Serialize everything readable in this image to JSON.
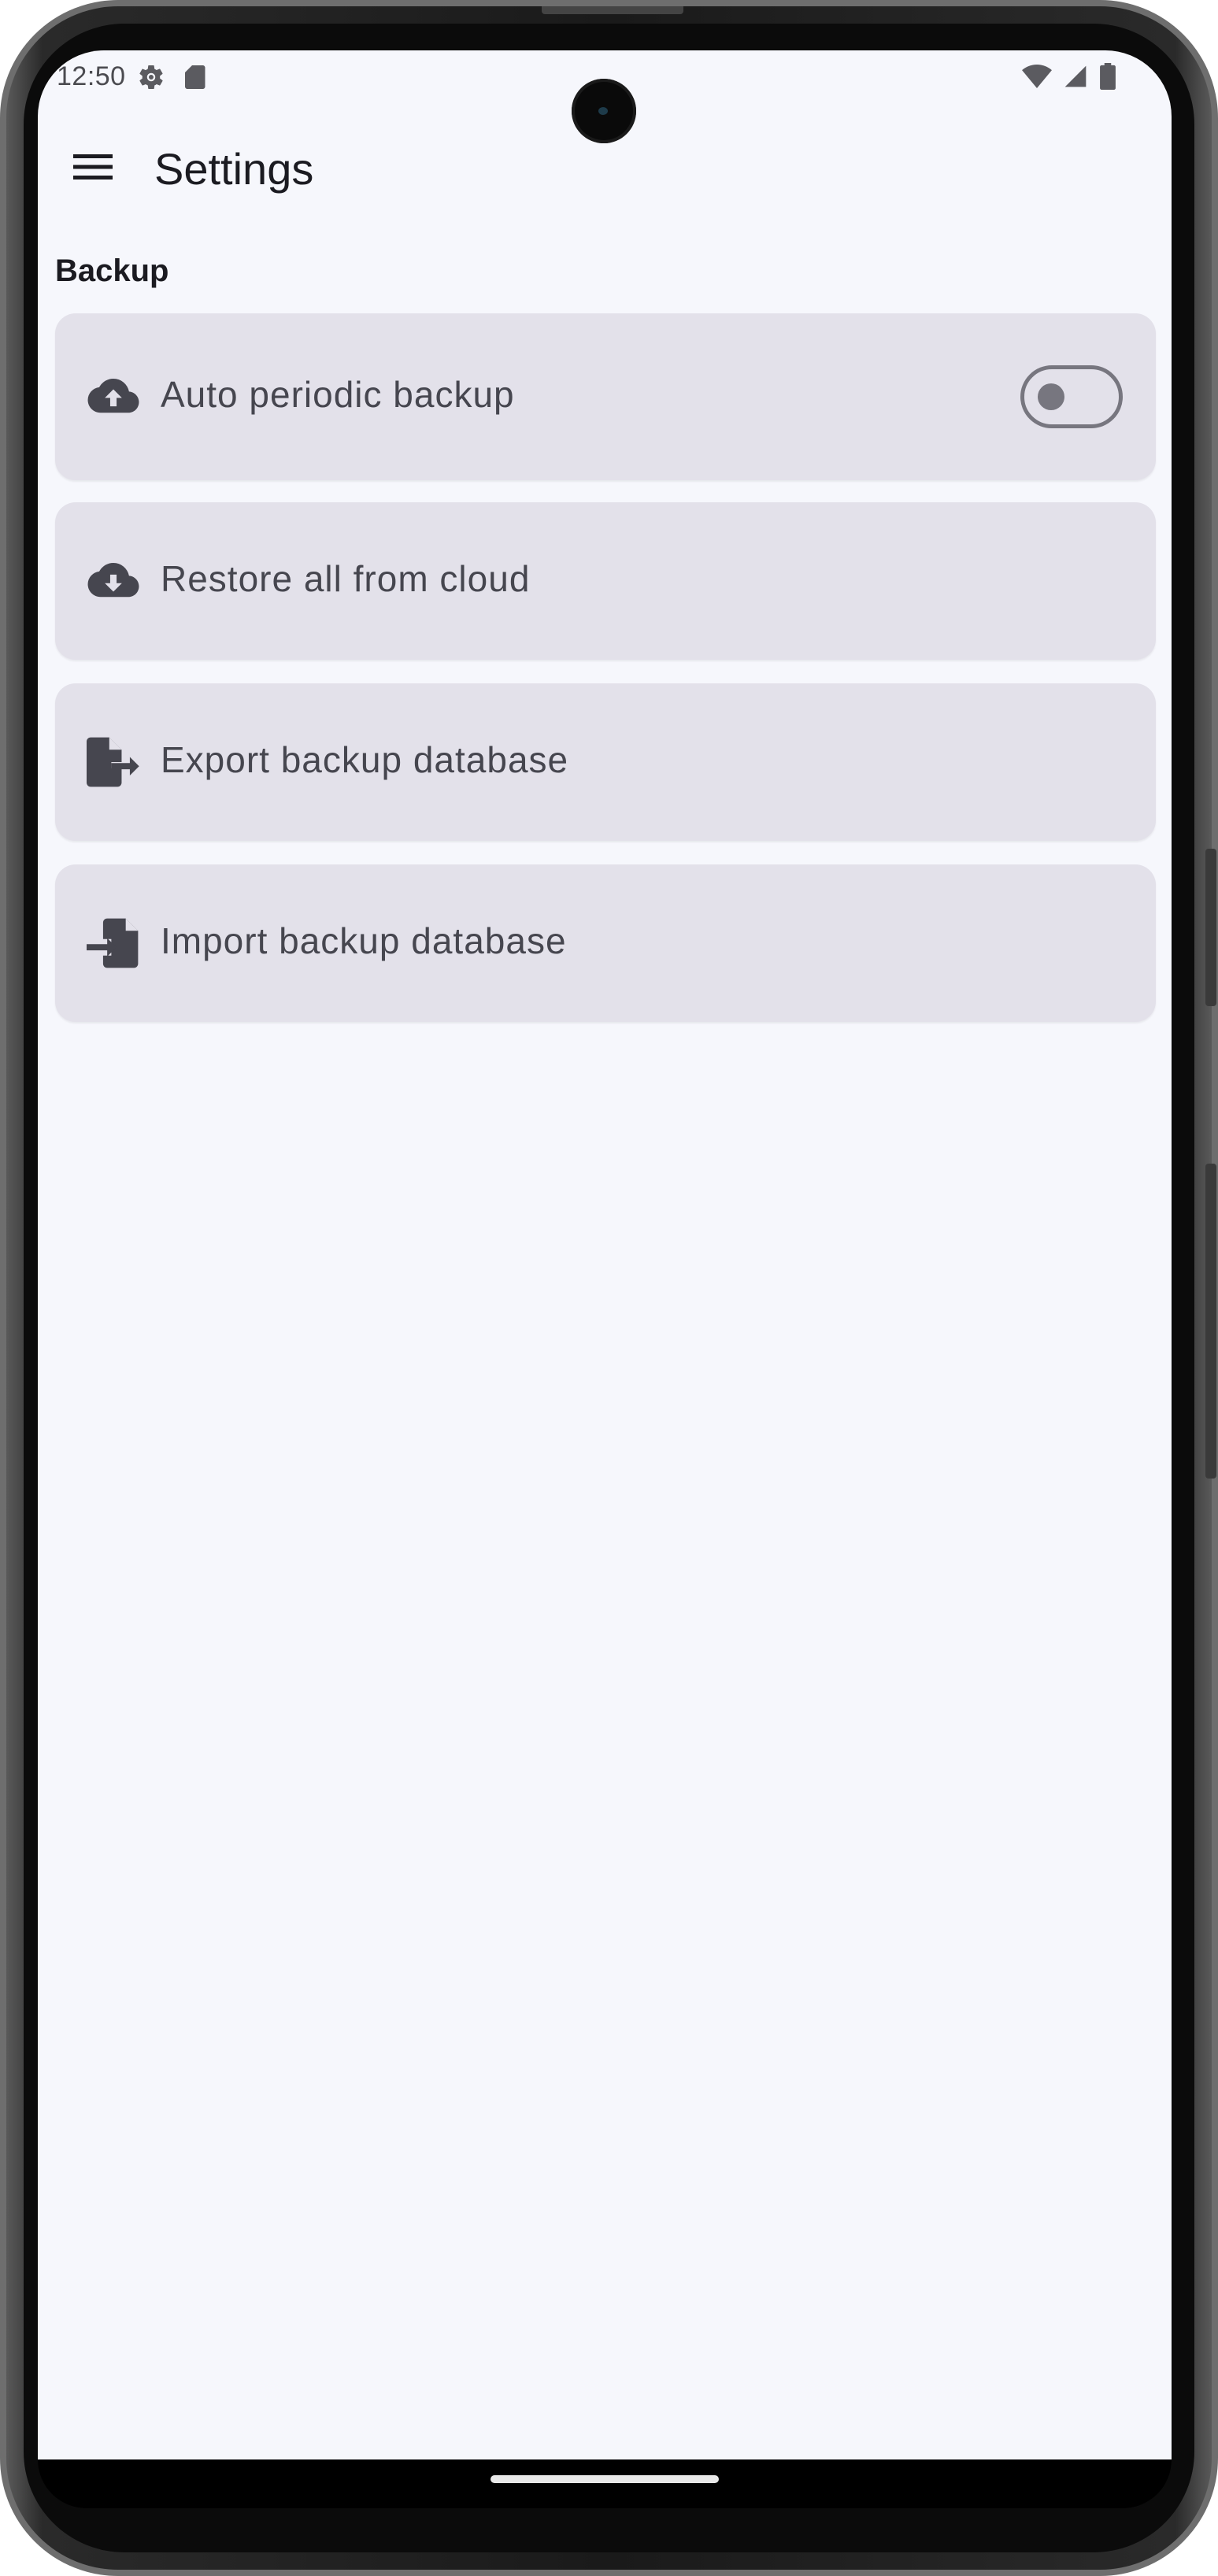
{
  "status_bar": {
    "time": "12:50",
    "left_icons": [
      "settings-gear-icon",
      "sd-card-icon"
    ],
    "right_icons": [
      "wifi-icon",
      "cell-signal-icon",
      "battery-icon"
    ]
  },
  "app_bar": {
    "menu_icon": "hamburger-menu-icon",
    "title": "Settings"
  },
  "sections": [
    {
      "header": "Backup",
      "items": [
        {
          "label": "Auto periodic backup",
          "icon": "cloud-upload-icon",
          "toggle": {
            "checked": false
          }
        },
        {
          "label": "Restore all from cloud",
          "icon": "cloud-download-icon"
        },
        {
          "label": "Export backup database",
          "icon": "file-export-icon"
        },
        {
          "label": "Import backup database",
          "icon": "file-import-icon"
        }
      ]
    }
  ],
  "colors": {
    "screen_bg": "#f6f7fc",
    "card_bg": "#e3e1ea",
    "text_primary": "#1b1b21",
    "text_secondary": "#46464f",
    "outline": "#77767f"
  }
}
